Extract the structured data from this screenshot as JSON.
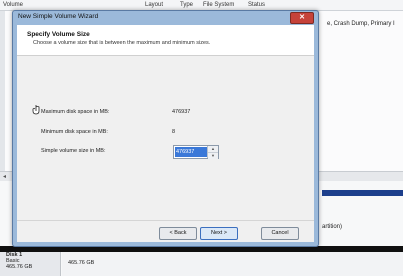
{
  "background": {
    "header_columns": [
      "Volume",
      "Layout",
      "Type",
      "File System",
      "Status"
    ],
    "right_text": "e, Crash Dump, Primary I",
    "partition_text": "artition)",
    "disk": {
      "name": "Disk 1",
      "type": "Basic",
      "size": "465.76 GB",
      "partition_size": "465.76 GB"
    }
  },
  "dialog": {
    "title": "New Simple Volume Wizard",
    "close_label": "✕",
    "header": {
      "title": "Specify Volume Size",
      "subtitle": "Choose a volume size that is between the maximum and minimum sizes."
    },
    "fields": [
      {
        "label": "Maximum disk space in MB:",
        "value": "476937"
      },
      {
        "label": "Minimum disk space in MB:",
        "value": "8"
      }
    ],
    "size_label": "Simple volume size in MB:",
    "size_value": "476937",
    "buttons": {
      "back": "< Back",
      "next": "Next >",
      "cancel": "Cancel"
    }
  }
}
